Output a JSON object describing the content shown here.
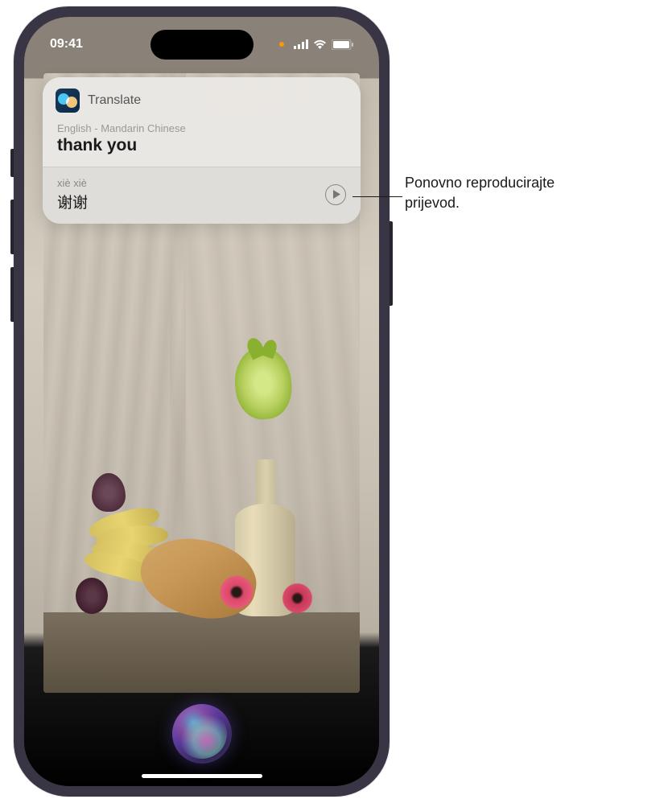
{
  "status_bar": {
    "time": "09:41"
  },
  "translate_card": {
    "app_name": "Translate",
    "language_pair": "English - Mandarin Chinese",
    "source_text": "thank you",
    "pinyin": "xiè xiè",
    "target_text": "谢谢"
  },
  "callout": {
    "line1": "Ponovno reproducirajte",
    "line2": "prijevod."
  }
}
